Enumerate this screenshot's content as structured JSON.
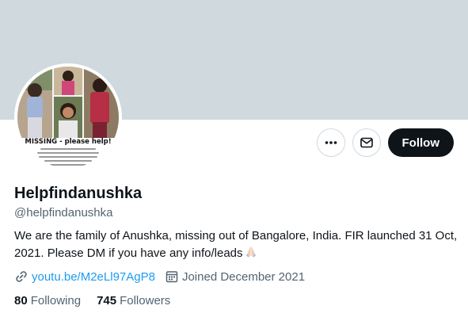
{
  "profile": {
    "display_name": "Helpfindanushka",
    "handle": "@helpfindanushka",
    "bio": "We are the family of Anushka, missing out of Bangalore, India. FIR launched 31 Oct, 2021. Please DM if you have any info/leads",
    "bio_emoji_icon": "folded-hands-icon",
    "website": "youtu.be/M2eLl97AgP8",
    "joined": "Joined December 2021",
    "following_count": "80",
    "following_label": "Following",
    "followers_count": "745",
    "followers_label": "Followers"
  },
  "avatar": {
    "poster_title": "MISSING - please help!"
  },
  "actions": {
    "more_icon": "more-dots-icon",
    "message_icon": "envelope-icon",
    "follow_label": "Follow"
  },
  "colors": {
    "banner": "#cfd9de",
    "accent_link": "#1d9bf0",
    "follow_button": "#0f1419",
    "secondary_text": "#536471"
  }
}
